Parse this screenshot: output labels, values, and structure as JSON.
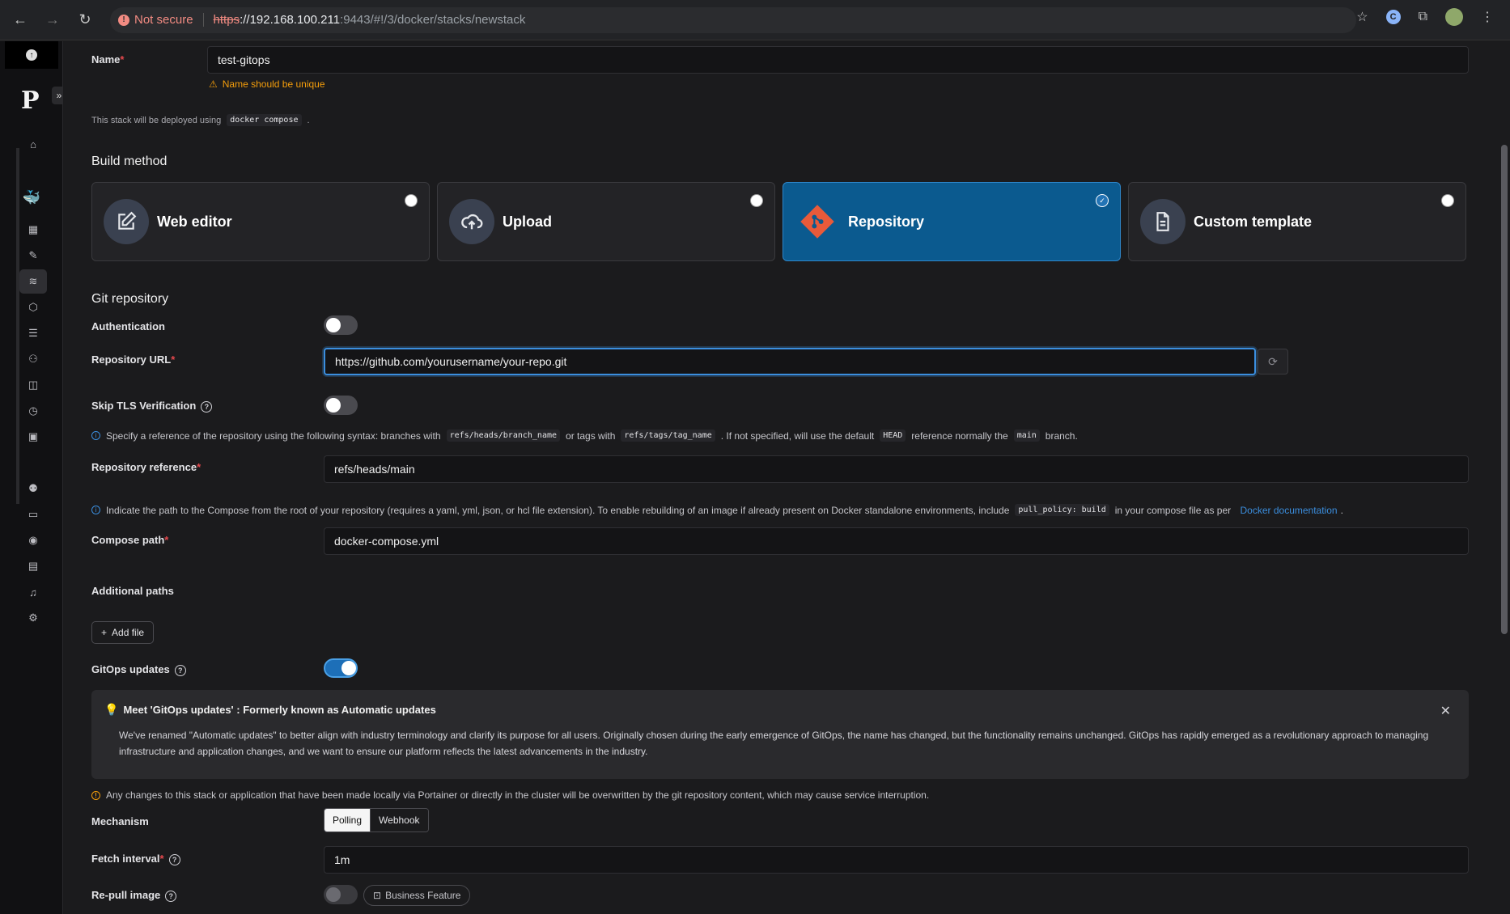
{
  "browser": {
    "not_secure": "Not secure",
    "url_proto": "https",
    "url_host": "://192.168.100.211",
    "url_rest": ":9443/#!/3/docker/stacks/newstack"
  },
  "form": {
    "name_label": "Name",
    "name_value": "test-gitops",
    "name_warning": "Name should be unique",
    "deploy_note_prefix": "This stack will be deployed using",
    "deploy_note_code": "docker compose",
    "deploy_note_suffix": ".",
    "build_method_title": "Build method",
    "methods": [
      {
        "label": "Web editor",
        "icon": "edit-icon"
      },
      {
        "label": "Upload",
        "icon": "cloud-upload-icon"
      },
      {
        "label": "Repository",
        "icon": "git-icon"
      },
      {
        "label": "Custom template",
        "icon": "file-text-icon"
      }
    ],
    "git_title": "Git repository",
    "auth_label": "Authentication",
    "repo_url_label": "Repository URL",
    "repo_url_value": "https://github.com/yourusername/your-repo.git",
    "skip_tls_label": "Skip TLS Verification",
    "ref_note": {
      "p1": "Specify a reference of the repository using the following syntax: branches with",
      "c1": "refs/heads/branch_name",
      "p2": "or tags with",
      "c2": "refs/tags/tag_name",
      "p3": ". If not specified, will use the default",
      "c3": "HEAD",
      "p4": "reference normally the",
      "c4": "main",
      "p5": "branch."
    },
    "repo_ref_label": "Repository reference",
    "repo_ref_value": "refs/heads/main",
    "path_note": {
      "p1": "Indicate the path to the Compose from the root of your repository (requires a yaml, yml, json, or hcl file extension).  To enable rebuilding of an image if already present on Docker standalone environments, include",
      "c1": "pull_policy: build",
      "p2": "in your compose file as per",
      "link": "Docker documentation",
      "p3": "."
    },
    "compose_path_label": "Compose path",
    "compose_path_value": "docker-compose.yml",
    "additional_paths_label": "Additional paths",
    "add_file_label": "Add file",
    "gitops_label": "GitOps updates",
    "banner": {
      "title": "Meet 'GitOps updates' : Formerly known as Automatic updates",
      "text": "We've renamed \"Automatic updates\" to better align with industry terminology and clarify its purpose for all users. Originally chosen during the early emergence of GitOps, the name has changed, but the functionality remains unchanged. GitOps has rapidly emerged as a revolutionary approach to managing infrastructure and application changes, and we want to ensure our platform reflects the latest advancements in the industry."
    },
    "overwrite_warning": "Any changes to this stack or application that have been made locally via Portainer or directly in the cluster will be overwritten by the git repository content, which may cause service interruption.",
    "mechanism_label": "Mechanism",
    "mechanism_options": [
      "Polling",
      "Webhook"
    ],
    "fetch_interval_label": "Fetch interval",
    "fetch_interval_value": "1m",
    "repull_label": "Re-pull image",
    "business_feature_label": "Business Feature"
  }
}
